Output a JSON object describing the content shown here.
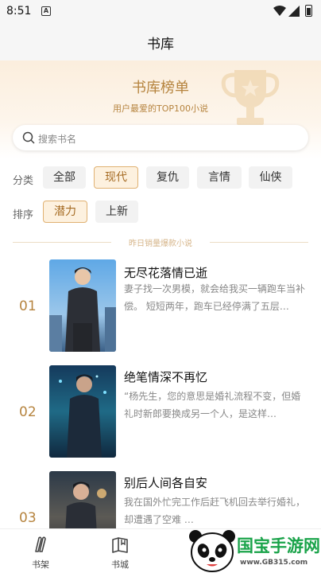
{
  "status_bar": {
    "time": "8:51",
    "notification_icon": "A"
  },
  "header": {
    "title": "书库"
  },
  "banner": {
    "title": "书库榜单",
    "subtitle": "用户最爱的TOP100小说",
    "decor_icon": "trophy-icon"
  },
  "search": {
    "placeholder": "搜索书名"
  },
  "filters": {
    "category_label": "分类",
    "categories": [
      "全部",
      "现代",
      "复仇",
      "言情",
      "仙侠"
    ],
    "selected_category": "现代",
    "sort_label": "排序",
    "sorts": [
      "潜力",
      "上新"
    ],
    "selected_sort": "潜力"
  },
  "section_divider": "昨日销量爆款小说",
  "books": [
    {
      "rank": "01",
      "title": "无尽花落情已逝",
      "desc": "妻子找一次男模，就会给我买一辆跑车当补偿。 短短两年，跑车已经停满了五层…"
    },
    {
      "rank": "02",
      "title": "绝笔情深不再忆",
      "desc": "“杨先生，您的意思是婚礼流程不变，但婚礼时新郎要换成另一个人，是这样…"
    },
    {
      "rank": "03",
      "title": "别后人间各自安",
      "desc": "我在国外忙完工作后赶飞机回去举行婚礼，却遭遇了空难 …"
    }
  ],
  "tab_bar": [
    {
      "label": "书架",
      "icon": "bookshelf-icon"
    },
    {
      "label": "书城",
      "icon": "bookstore-icon"
    }
  ],
  "watermark": {
    "title": "国宝手游网",
    "url": "www.GB315.com"
  },
  "colors": {
    "accent": "#b6843f",
    "chip_active_bg": "#fdf1df",
    "chip_active_border": "#e0b172"
  }
}
